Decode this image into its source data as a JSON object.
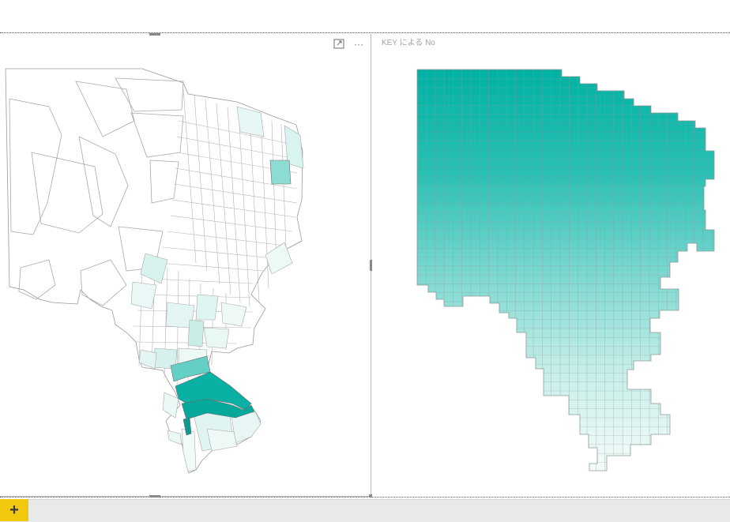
{
  "visuals": {
    "left_map": {
      "focus_icon": "focus-mode-icon",
      "more_options": "···"
    },
    "right_map": {
      "title": "KEY による No"
    }
  },
  "footer": {
    "add_page_label": "+"
  },
  "colors": {
    "accent_dark": "#00a99d",
    "accent_mid": "#4fcbc1",
    "accent_light": "#e7f7f5",
    "outline": "#a9a9a9",
    "page_tab_add": "#f2c80f"
  }
}
